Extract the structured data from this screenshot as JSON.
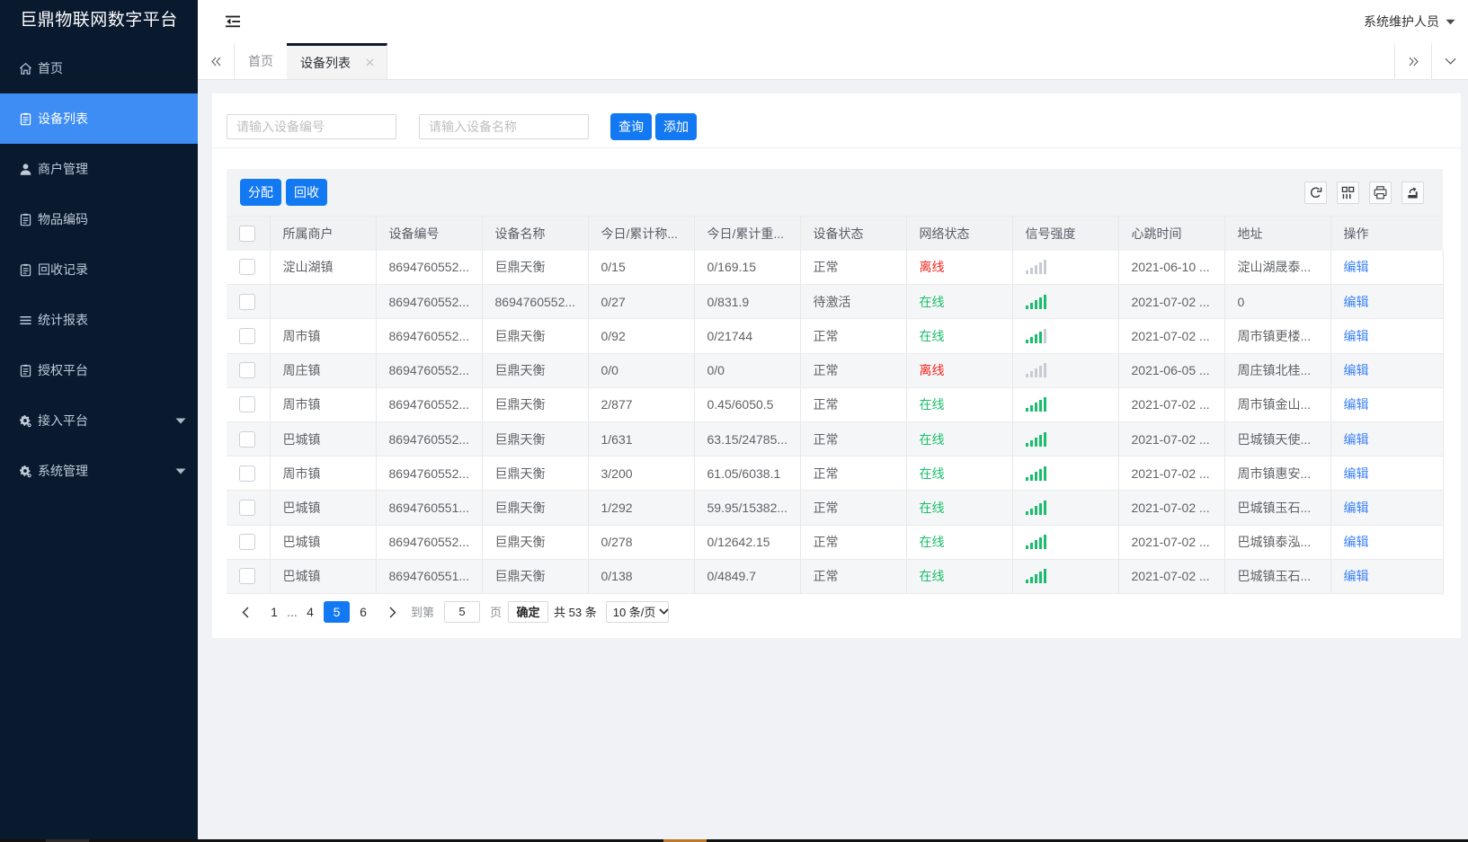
{
  "app": {
    "title": "巨鼎物联网数字平台"
  },
  "header": {
    "user": "系统维护人员"
  },
  "sidebar": {
    "items": [
      {
        "label": "首页",
        "icon": "home",
        "active": false,
        "expandable": false
      },
      {
        "label": "设备列表",
        "icon": "doc",
        "active": true,
        "expandable": false
      },
      {
        "label": "商户管理",
        "icon": "user",
        "active": false,
        "expandable": false
      },
      {
        "label": "物品编码",
        "icon": "doc",
        "active": false,
        "expandable": false
      },
      {
        "label": "回收记录",
        "icon": "doc",
        "active": false,
        "expandable": false
      },
      {
        "label": "统计报表",
        "icon": "list",
        "active": false,
        "expandable": false
      },
      {
        "label": "授权平台",
        "icon": "doc",
        "active": false,
        "expandable": false
      },
      {
        "label": "接入平台",
        "icon": "gear",
        "active": false,
        "expandable": true
      },
      {
        "label": "系统管理",
        "icon": "gear",
        "active": false,
        "expandable": true
      }
    ]
  },
  "tabs": [
    {
      "label": "首页",
      "active": false,
      "closable": false
    },
    {
      "label": "设备列表",
      "active": true,
      "closable": true
    }
  ],
  "search": {
    "device_code_placeholder": "请输入设备编号",
    "device_name_placeholder": "请输入设备名称",
    "query": "查询",
    "add": "添加"
  },
  "toolbar": {
    "assign": "分配",
    "recycle": "回收"
  },
  "table": {
    "columns": [
      "所属商户",
      "设备编号",
      "设备名称",
      "今日/累计称...",
      "今日/累计重...",
      "设备状态",
      "网络状态",
      "信号强度",
      "心跳时间",
      "地址",
      "操作"
    ],
    "action_label": "编辑",
    "rows": [
      {
        "merchant": "淀山湖镇",
        "device_no": "8694760552...",
        "device_name": "巨鼎天衡",
        "count": "0/15",
        "weight": "0/169.15",
        "device_status": "正常",
        "network": "离线",
        "online": false,
        "signal_green": 0,
        "heartbeat": "2021-06-10 ...",
        "address": "淀山湖晟泰..."
      },
      {
        "merchant": "",
        "device_no": "8694760552...",
        "device_name": "8694760552...",
        "count": "0/27",
        "weight": "0/831.9",
        "device_status": "待激活",
        "network": "在线",
        "online": true,
        "signal_green": 5,
        "heartbeat": "2021-07-02 ...",
        "address": "0"
      },
      {
        "merchant": "周市镇",
        "device_no": "8694760552...",
        "device_name": "巨鼎天衡",
        "count": "0/92",
        "weight": "0/21744",
        "device_status": "正常",
        "network": "在线",
        "online": true,
        "signal_green": 4,
        "heartbeat": "2021-07-02 ...",
        "address": "周市镇更楼..."
      },
      {
        "merchant": "周庄镇",
        "device_no": "8694760552...",
        "device_name": "巨鼎天衡",
        "count": "0/0",
        "weight": "0/0",
        "device_status": "正常",
        "network": "离线",
        "online": false,
        "signal_green": 0,
        "heartbeat": "2021-06-05 ...",
        "address": "周庄镇北桂..."
      },
      {
        "merchant": "周市镇",
        "device_no": "8694760552...",
        "device_name": "巨鼎天衡",
        "count": "2/877",
        "weight": "0.45/6050.5",
        "device_status": "正常",
        "network": "在线",
        "online": true,
        "signal_green": 5,
        "heartbeat": "2021-07-02 ...",
        "address": "周市镇金山..."
      },
      {
        "merchant": "巴城镇",
        "device_no": "8694760552...",
        "device_name": "巨鼎天衡",
        "count": "1/631",
        "weight": "63.15/24785...",
        "device_status": "正常",
        "network": "在线",
        "online": true,
        "signal_green": 5,
        "heartbeat": "2021-07-02 ...",
        "address": "巴城镇天使..."
      },
      {
        "merchant": "周市镇",
        "device_no": "8694760552...",
        "device_name": "巨鼎天衡",
        "count": "3/200",
        "weight": "61.05/6038.1",
        "device_status": "正常",
        "network": "在线",
        "online": true,
        "signal_green": 5,
        "heartbeat": "2021-07-02 ...",
        "address": "周市镇惠安..."
      },
      {
        "merchant": "巴城镇",
        "device_no": "8694760551...",
        "device_name": "巨鼎天衡",
        "count": "1/292",
        "weight": "59.95/15382...",
        "device_status": "正常",
        "network": "在线",
        "online": true,
        "signal_green": 5,
        "heartbeat": "2021-07-02 ...",
        "address": "巴城镇玉石..."
      },
      {
        "merchant": "巴城镇",
        "device_no": "8694760552...",
        "device_name": "巨鼎天衡",
        "count": "0/278",
        "weight": "0/12642.15",
        "device_status": "正常",
        "network": "在线",
        "online": true,
        "signal_green": 5,
        "heartbeat": "2021-07-02 ...",
        "address": "巴城镇泰泓..."
      },
      {
        "merchant": "巴城镇",
        "device_no": "8694760551...",
        "device_name": "巨鼎天衡",
        "count": "0/138",
        "weight": "0/4849.7",
        "device_status": "正常",
        "network": "在线",
        "online": true,
        "signal_green": 5,
        "heartbeat": "2021-07-02 ...",
        "address": "巴城镇玉石..."
      }
    ]
  },
  "pagination": {
    "pages": [
      "1",
      "...",
      "4",
      "5",
      "6"
    ],
    "active": "5",
    "jump_prefix": "到第",
    "jump_value": "5",
    "jump_suffix": "页",
    "confirm": "确定",
    "total": "共 53 条",
    "page_size": "10 条/页"
  },
  "colors": {
    "sidebar_bg": "#091a2f",
    "sidebar_active": "#3e8df5",
    "accent_blue": "#1379f2",
    "link_blue": "#3b82f6",
    "online_green": "#19be6b",
    "offline_red": "#f5231d",
    "signal_green": "#1abd6d",
    "signal_gray": "#c7ccd3"
  }
}
